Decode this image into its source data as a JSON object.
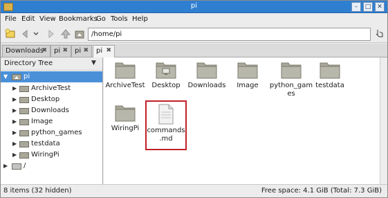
{
  "window": {
    "title": "pi"
  },
  "menu": [
    "File",
    "Edit",
    "View",
    "Bookmarks",
    "Go",
    "Tools",
    "Help"
  ],
  "toolbar": {
    "path_value": "/home/pi"
  },
  "tabs": [
    {
      "label": "Downloads",
      "active": false
    },
    {
      "label": "pi",
      "active": false
    },
    {
      "label": "pi",
      "active": false
    },
    {
      "label": "pi",
      "active": true
    }
  ],
  "sidebar": {
    "header": "Directory Tree",
    "tree": [
      {
        "label": "pi",
        "expander": "▼",
        "selected": true
      },
      {
        "label": "ArchiveTest",
        "expander": "▶"
      },
      {
        "label": "Desktop",
        "expander": "▶"
      },
      {
        "label": "Downloads",
        "expander": "▶"
      },
      {
        "label": "Image",
        "expander": "▶"
      },
      {
        "label": "python_games",
        "expander": "▶"
      },
      {
        "label": "testdata",
        "expander": "▶"
      },
      {
        "label": "WiringPi",
        "expander": "▶"
      },
      {
        "label": "/",
        "expander": "▶"
      }
    ]
  },
  "files": [
    {
      "name": "ArchiveTest",
      "type": "folder"
    },
    {
      "name": "Desktop",
      "type": "folder-desktop"
    },
    {
      "name": "Downloads",
      "type": "folder"
    },
    {
      "name": "Image",
      "type": "folder"
    },
    {
      "name": "python_games",
      "type": "folder"
    },
    {
      "name": "testdata",
      "type": "folder"
    },
    {
      "name": "WiringPi",
      "type": "folder"
    },
    {
      "name": "commands.md",
      "type": "file",
      "highlighted": true
    }
  ],
  "status": {
    "items": "8 items (32 hidden)",
    "free_space": "Free space: 4.1 GiB (Total: 7.3 GiB)"
  },
  "colors": {
    "selection": "#4a90d9",
    "folder": "#a8a79a",
    "highlight_border": "#c0202a"
  }
}
